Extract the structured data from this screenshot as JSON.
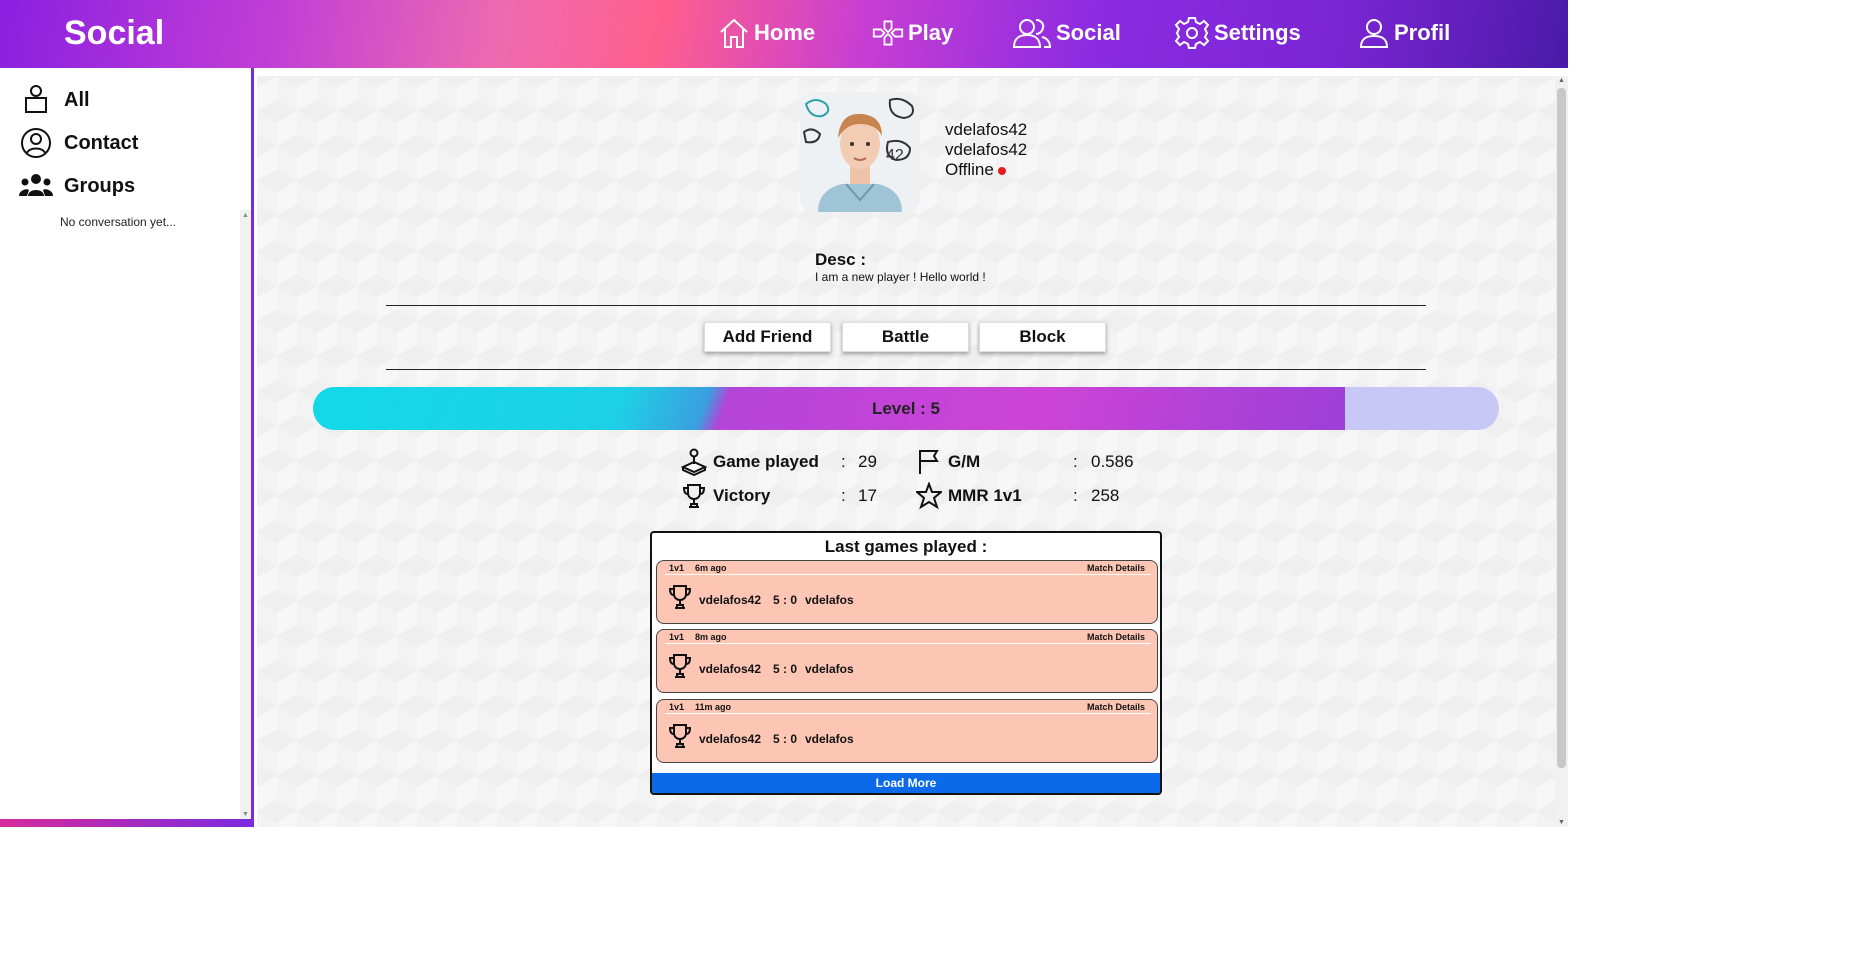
{
  "header": {
    "title": "Social",
    "nav": [
      {
        "label": "Home",
        "icon": "home-icon"
      },
      {
        "label": "Play",
        "icon": "gamepad-icon"
      },
      {
        "label": "Social",
        "icon": "users-icon"
      },
      {
        "label": "Settings",
        "icon": "gear-icon"
      },
      {
        "label": "Profil",
        "icon": "user-icon"
      }
    ]
  },
  "sidebar": {
    "items": [
      {
        "label": "All",
        "icon": "person-icon"
      },
      {
        "label": "Contact",
        "icon": "user-circle-icon"
      },
      {
        "label": "Groups",
        "icon": "group-icon"
      }
    ],
    "empty_text": "No conversation yet..."
  },
  "profile": {
    "username": "vdelafos42",
    "login": "vdelafos42",
    "status": "Offline",
    "status_color": "#e81919",
    "desc_title": "Desc :",
    "desc_text": "I am a new player ! Hello world !"
  },
  "actions": {
    "add_friend": "Add Friend",
    "battle": "Battle",
    "block": "Block"
  },
  "level": {
    "label": "Level : 5",
    "progress": 0.87
  },
  "stats": {
    "games_played": {
      "label": "Game played",
      "value": "29"
    },
    "victory": {
      "label": "Victory",
      "value": "17"
    },
    "gm": {
      "label": "G/M",
      "value": "0.586"
    },
    "mmr": {
      "label": "MMR 1v1",
      "value": "258"
    },
    "colon": ":"
  },
  "games": {
    "title": "Last games played :",
    "details_label": "Match Details",
    "load_more": "Load More",
    "list": [
      {
        "mode": "1v1",
        "ago": "6m ago",
        "player1": "vdelafos42",
        "score": "5 : 0",
        "player2": "vdelafos"
      },
      {
        "mode": "1v1",
        "ago": "8m ago",
        "player1": "vdelafos42",
        "score": "5 : 0",
        "player2": "vdelafos"
      },
      {
        "mode": "1v1",
        "ago": "11m ago",
        "player1": "vdelafos42",
        "score": "5 : 0",
        "player2": "vdelafos"
      }
    ]
  },
  "colors": {
    "accent": "#7a2be0",
    "game_card": "#fdc6b4",
    "load_more": "#0a6ae8"
  }
}
